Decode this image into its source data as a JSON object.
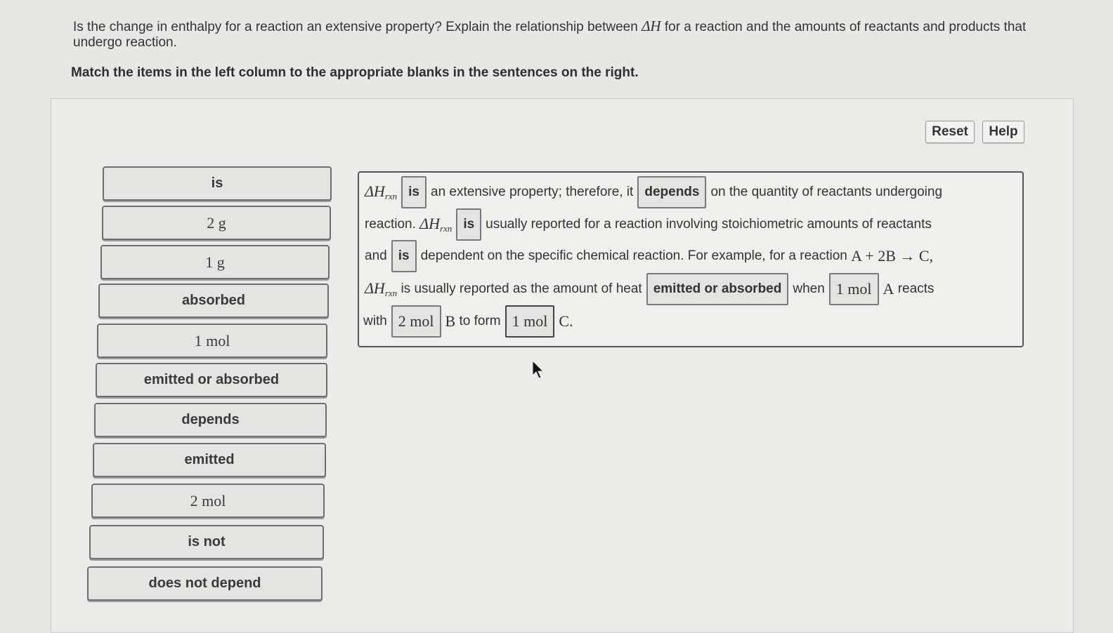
{
  "question": {
    "part1": "Is the change in enthalpy for a reaction an extensive property? Explain the relationship between ",
    "delta_h": "ΔH",
    "part2": " for a reaction and the amounts of reactants and products that undergo reaction."
  },
  "instruction": "Match the items in the left column to the appropriate blanks in the sentences on the right.",
  "toolbar": {
    "reset_label": "Reset",
    "help_label": "Help"
  },
  "answer_bank": [
    {
      "label": "is"
    },
    {
      "label": "2 g"
    },
    {
      "label": "1 g"
    },
    {
      "label": "absorbed"
    },
    {
      "label": "1 mol"
    },
    {
      "label": "emitted or absorbed"
    },
    {
      "label": "depends"
    },
    {
      "label": "emitted"
    },
    {
      "label": "2 mol"
    },
    {
      "label": "is not"
    },
    {
      "label": "does not depend"
    }
  ],
  "sentence": {
    "dh": "ΔH",
    "rxn": "rxn",
    "t1": "an extensive property; therefore, it",
    "t2": "on the quantity of reactants undergoing",
    "t3": "reaction.",
    "t4": "usually reported for a reaction involving stoichiometric amounts of reactants",
    "t5": "and",
    "t6": "dependent on the specific chemical reaction. For example, for a reaction",
    "reaction": "A + 2B → C,",
    "t7": "is usually reported as the amount of heat",
    "t8": "when",
    "t9": "A",
    "t10": "reacts",
    "t11": "with",
    "t12": "B",
    "t13": "to form",
    "t14": "C.",
    "blanks": {
      "b1": "is",
      "b2": "depends",
      "b3": "is",
      "b4": "is",
      "b5": "emitted or absorbed",
      "b6": "1 mol",
      "b7": "2 mol",
      "b8": "1 mol"
    }
  }
}
